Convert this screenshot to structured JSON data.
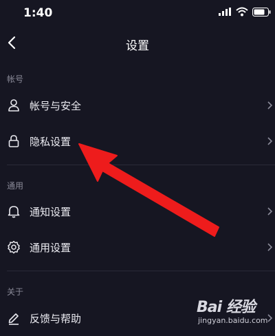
{
  "status_bar": {
    "time": "1:40"
  },
  "nav": {
    "title": "设置"
  },
  "sections": {
    "account": "帐号",
    "general": "通用",
    "about": "关于"
  },
  "items": {
    "account_security": "帐号与安全",
    "privacy": "隐私设置",
    "notification": "通知设置",
    "general": "通用设置",
    "feedback": "反馈与帮助"
  },
  "watermark": {
    "logo": "Bai 经验",
    "url": "jingyan.baidu.com"
  },
  "icons": {
    "back": "chevron-left-icon",
    "account": "user-icon",
    "privacy": "lock-icon",
    "notification": "bell-icon",
    "general": "gear-icon",
    "feedback": "pencil-icon",
    "row_arrow": "chevron-right-icon"
  },
  "colors": {
    "background": "#161622",
    "annotation_arrow": "#ee1c1c"
  }
}
